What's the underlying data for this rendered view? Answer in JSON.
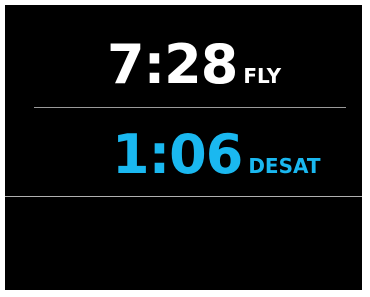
{
  "fly": {
    "time": "7:28",
    "label": "FLY",
    "color": "#ffffff"
  },
  "desat": {
    "time": "1:06",
    "label": "DESAT",
    "color": "#1ab8f0"
  },
  "colors": {
    "background": "#000000",
    "divider": "#9a9a9a"
  }
}
